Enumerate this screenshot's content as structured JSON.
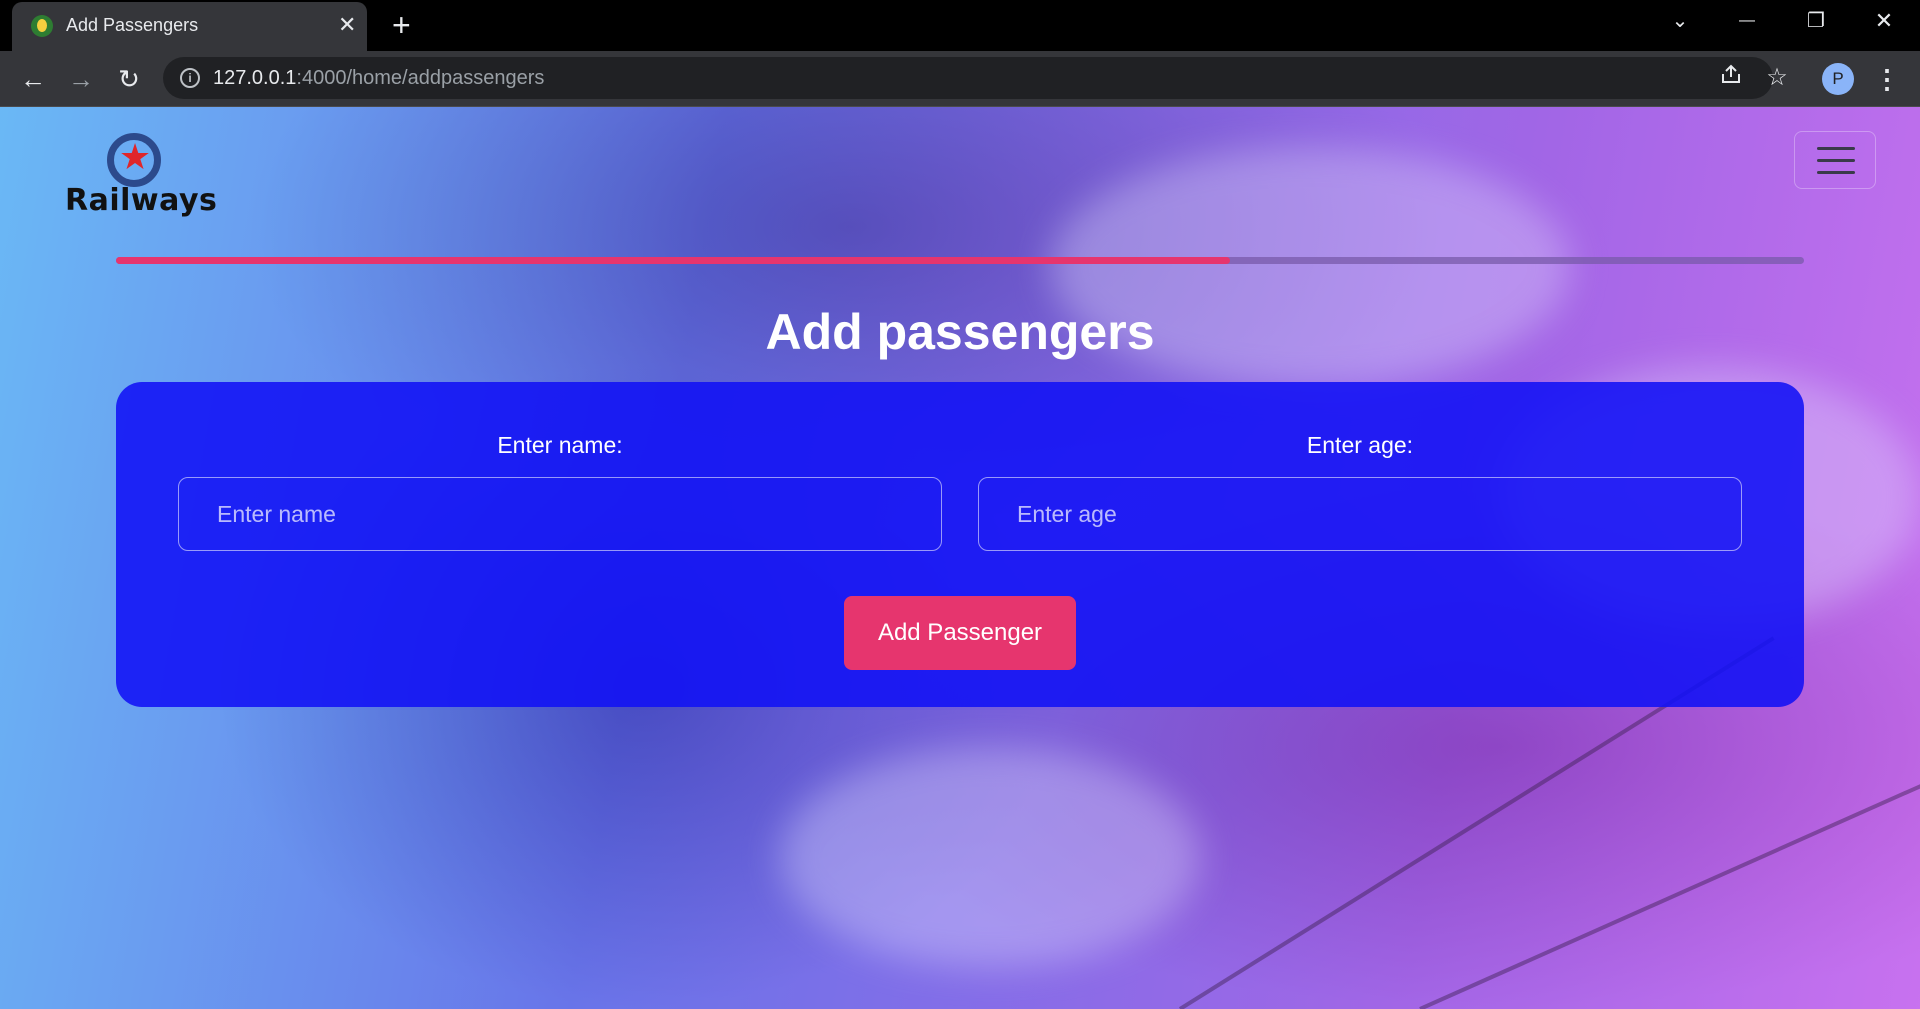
{
  "browser": {
    "tab_title": "Add Passengers",
    "tab_close": "✕",
    "new_tab": "+",
    "url_host": "127.0.0.1",
    "url_path": ":4000/home/addpassengers",
    "profile_initial": "P",
    "window_controls": {
      "dropdown": "⌄",
      "minimize": "—",
      "restore": "❐",
      "close": "✕"
    },
    "nav": {
      "back": "←",
      "forward": "→",
      "reload": "↻"
    }
  },
  "site": {
    "logo_text": "Railways",
    "progress_percent": 66,
    "title": "Add passengers",
    "form": {
      "name_label": "Enter name:",
      "name_placeholder": "Enter name",
      "name_value": "",
      "age_label": "Enter age:",
      "age_placeholder": "Enter age",
      "age_value": "",
      "submit_label": "Add Passenger"
    }
  },
  "colors": {
    "accent_pink": "#e6356e",
    "form_blue": "#1111f5",
    "logo_star": "#e0262a",
    "logo_ring": "#2c4a8c"
  },
  "icons": [
    "favicon-icon",
    "close-icon",
    "plus-icon",
    "chevron-down-icon",
    "minimize-icon",
    "restore-icon",
    "back-arrow-icon",
    "forward-arrow-icon",
    "reload-icon",
    "info-icon",
    "share-icon",
    "star-icon",
    "kebab-menu-icon",
    "hamburger-icon",
    "star-logo-icon"
  ]
}
